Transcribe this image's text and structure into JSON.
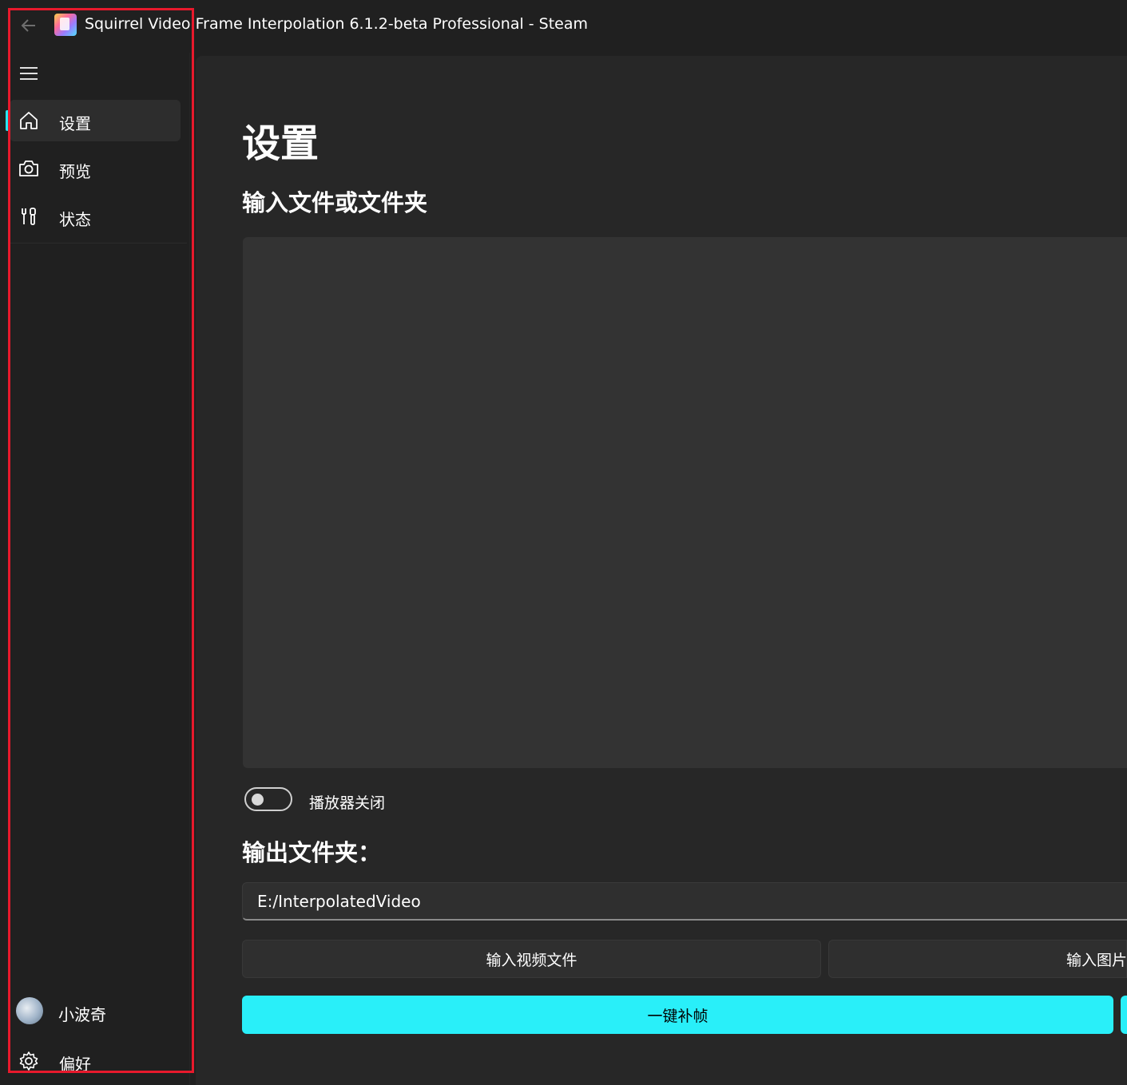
{
  "window": {
    "title": "Squirrel Video Frame Interpolation 6.1.2-beta Professional - Steam"
  },
  "sidebar": {
    "items": [
      {
        "label": "设置",
        "icon": "home-icon",
        "active": true
      },
      {
        "label": "预览",
        "icon": "camera-icon",
        "active": false
      },
      {
        "label": "状态",
        "icon": "tools-icon",
        "active": false
      }
    ],
    "user": {
      "name": "小波奇"
    },
    "preferences": {
      "label": "偏好",
      "icon": "gear-icon"
    }
  },
  "main": {
    "title": "设置",
    "input_section_label": "输入文件或文件夹",
    "player_toggle_label": "播放器关闭",
    "player_toggle_on": false,
    "output_section_label": "输出文件夹：",
    "output_path": "E:/InterpolatedVideo",
    "input_video_button": "输入视频文件",
    "input_image_button": "输入图片",
    "run_button": "一键补帧"
  },
  "colors": {
    "accent": "#29eff9",
    "highlight_box": "#e8192c",
    "background": "#202020",
    "panel": "#272727"
  }
}
